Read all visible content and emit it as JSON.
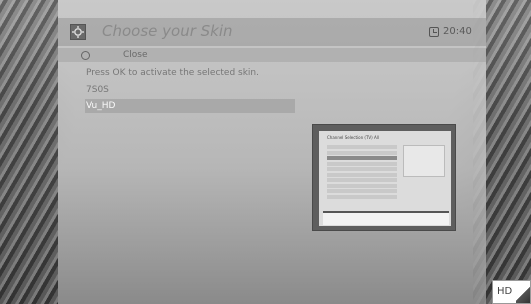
{
  "header": {
    "title": "Choose your Skin",
    "time": "20:40",
    "settings_icon": "settings-icon",
    "clock_icon": "clock-icon"
  },
  "close": {
    "label": "Close",
    "icon": "circle-button-icon"
  },
  "instruction": "Press OK to activate the selected skin.",
  "skins": [
    {
      "label": "7S0S",
      "selected": false
    },
    {
      "label": "Vu_HD",
      "selected": true
    }
  ],
  "preview": {
    "title": "Channel Selection (TV) All"
  },
  "badge": {
    "label": "HD"
  },
  "colors": {
    "selected_bg": "#a9a9a9",
    "selected_text": "#fafafa",
    "text": "#777777"
  }
}
